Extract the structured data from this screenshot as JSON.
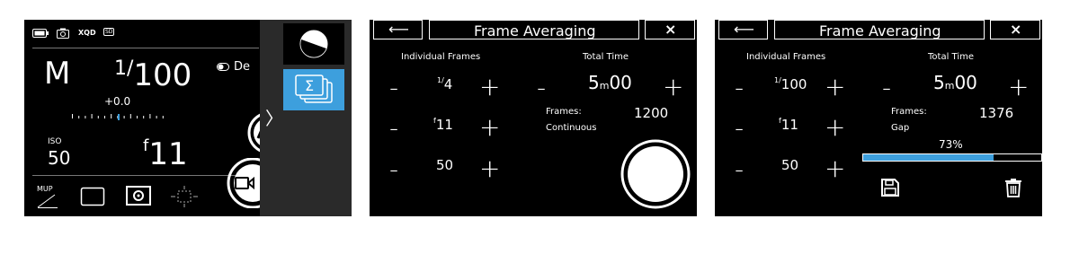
{
  "panel1": {
    "status_icons": [
      "battery-icon",
      "camera-icon",
      "xqd-card-icon",
      "sd-card-icon"
    ],
    "xqd_label": "XQD",
    "sd_label": "SD",
    "mode": "M",
    "shutter_num": "1/",
    "shutter_den": "100",
    "toggle_label": "De",
    "exposure_comp": "+0.0",
    "iso_label": "ISO",
    "iso_value": "50",
    "aperture_prefix": "f",
    "aperture_value": "11",
    "mup_label": "MUP",
    "side_chevron": "〉",
    "accent": "#3d9fdd"
  },
  "panel2": {
    "back_glyph": "⟵",
    "title": "Frame Averaging",
    "close_glyph": "×",
    "individual_frames_label": "Individual Frames",
    "total_time_label": "Total Time",
    "shutter_prefix": "1/",
    "shutter_value": "4",
    "aperture_prefix": "f",
    "aperture_value": "11",
    "iso_value": "50",
    "time_min": "5",
    "time_unit": "m",
    "time_sec": "00",
    "frames_label": "Frames:",
    "frames_value": "1200",
    "mode_label": "Continuous",
    "minus": "-",
    "plus": "+"
  },
  "panel3": {
    "back_glyph": "⟵",
    "title": "Frame Averaging",
    "close_glyph": "×",
    "individual_frames_label": "Individual Frames",
    "total_time_label": "Total Time",
    "shutter_prefix": "1/",
    "shutter_value": "100",
    "aperture_prefix": "f",
    "aperture_value": "11",
    "iso_value": "50",
    "time_min": "5",
    "time_unit": "m",
    "time_sec": "00",
    "frames_label": "Frames:",
    "frames_value": "1376",
    "mode_label": "Gap",
    "progress_text": "73%",
    "progress": 0.73,
    "minus": "-",
    "plus": "+",
    "accent": "#3d9fdd"
  }
}
